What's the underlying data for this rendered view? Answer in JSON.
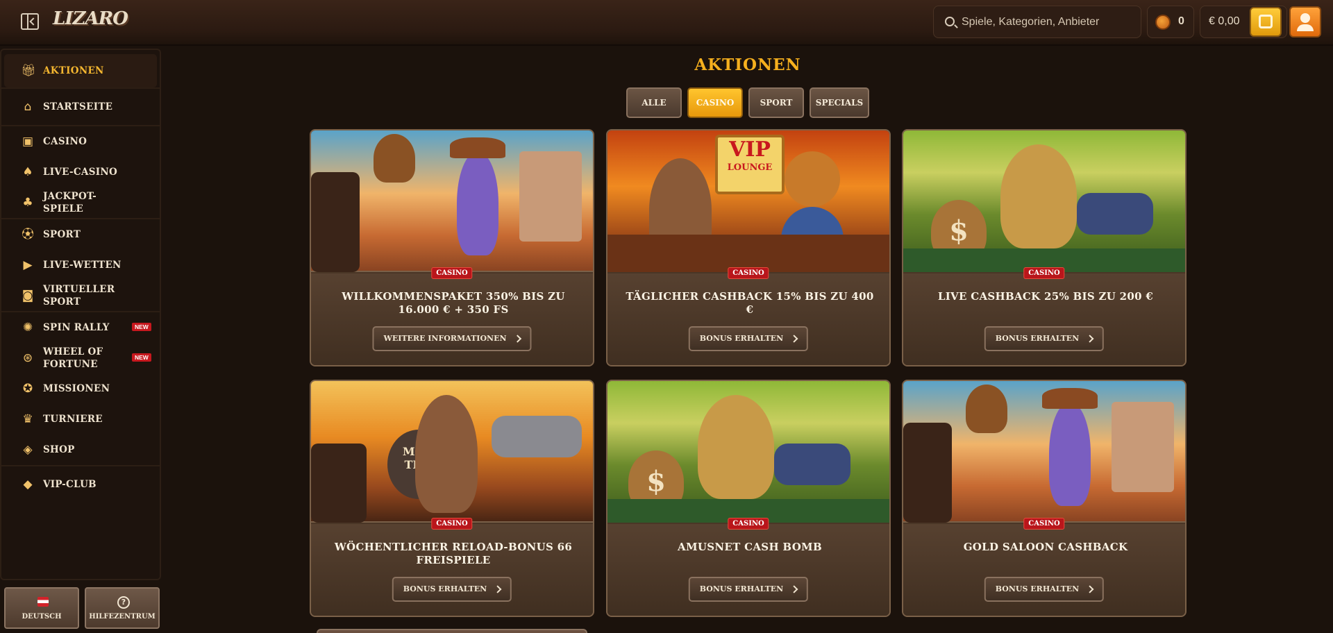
{
  "header": {
    "logo_text": "LIZARO",
    "search_placeholder": "Spiele, Kategorien, Anbieter",
    "coins": "0",
    "balance": "€ 0,00"
  },
  "sidebar": {
    "groups": [
      [
        {
          "label": "AKTIONEN",
          "icon": "gift-icon",
          "active": true
        }
      ],
      [
        {
          "label": "STARTSEITE",
          "icon": "home-icon"
        }
      ],
      [
        {
          "label": "CASINO",
          "icon": "slot-machine-icon"
        },
        {
          "label": "LIVE-CASINO",
          "icon": "cards-icon"
        },
        {
          "label": "JACKPOT-SPIELE",
          "icon": "clover-icon"
        }
      ],
      [
        {
          "label": "SPORT",
          "icon": "soccer-ball-icon"
        },
        {
          "label": "LIVE-WETTEN",
          "icon": "play-icon"
        },
        {
          "label": "VIRTUELLER SPORT",
          "icon": "virtual-sport-icon"
        }
      ],
      [
        {
          "label": "SPIN RALLY",
          "icon": "rally-icon",
          "badge": "NEW"
        },
        {
          "label": "WHEEL OF FORTUNE",
          "icon": "wheel-icon",
          "badge": "NEW"
        },
        {
          "label": "MISSIONEN",
          "icon": "medal-icon"
        },
        {
          "label": "TURNIERE",
          "icon": "trophy-icon"
        },
        {
          "label": "SHOP",
          "icon": "shop-basket-icon"
        }
      ],
      [
        {
          "label": "VIP-CLUB",
          "icon": "diamond-icon"
        }
      ]
    ],
    "language_label": "DEUTSCH",
    "help_label": "HILFEZENTRUM"
  },
  "main": {
    "title": "AKTIONEN",
    "filters": [
      "ALLE",
      "CASINO",
      "SPORT",
      "SPECIALS"
    ],
    "active_filter": "CASINO",
    "cards": [
      {
        "tag": "CASINO",
        "title": "WILLKOMMENSPAKET 350% BIS ZU 16.000 € + 350 FS",
        "cta": "WEITERE INFORMATIONEN"
      },
      {
        "tag": "CASINO",
        "title": "TÄGLICHER CASHBACK 15% BIS ZU 400 €",
        "cta": "BONUS ERHALTEN"
      },
      {
        "tag": "CASINO",
        "title": "LIVE CASHBACK 25% BIS ZU 200 €",
        "cta": "BONUS ERHALTEN"
      },
      {
        "tag": "CASINO",
        "title": "WÖCHENTLICHER RELOAD-BONUS 66 FREISPIELE",
        "cta": "BONUS ERHALTEN"
      },
      {
        "tag": "CASINO",
        "title": "AMUSNET CASH BOMB",
        "cta": "BONUS ERHALTEN"
      },
      {
        "tag": "CASINO",
        "title": "GOLD SALOON CASHBACK",
        "cta": "BONUS ERHALTEN"
      }
    ],
    "art_text": {
      "vip_sign_line1": "VIP",
      "vip_sign_line2": "LOUNGE",
      "bag_symbol": "$",
      "sack_text_line1": "MON",
      "sack_text_line2": "THU"
    }
  },
  "colors": {
    "accent_gold": "#f6b01e",
    "tag_red": "#b9161b",
    "background": "#1b120c"
  }
}
